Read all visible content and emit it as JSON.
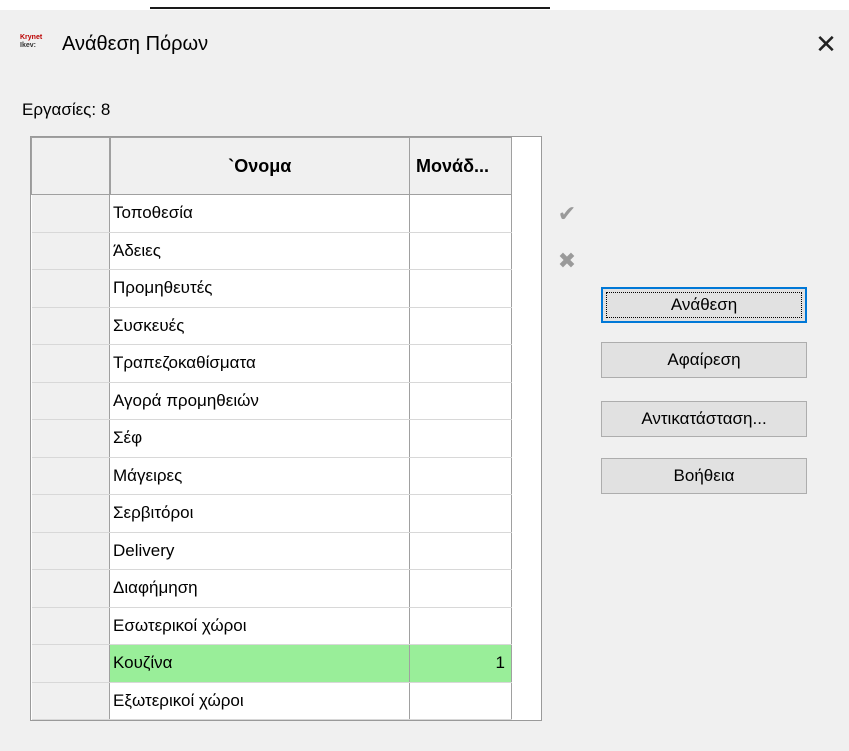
{
  "window": {
    "title": "Ανάθεση Πόρων",
    "icon_text_1": "Krynet",
    "icon_text_2": "Ikev:",
    "close_icon": "close-x-icon"
  },
  "tasks_label": "Εργασίες: 8",
  "table": {
    "columns": [
      "",
      "`Ονομα",
      "Μονάδ..."
    ],
    "rows": [
      {
        "name": "Τοποθεσία",
        "units": ""
      },
      {
        "name": "Άδειες",
        "units": ""
      },
      {
        "name": "Προμηθευτές",
        "units": ""
      },
      {
        "name": "Συσκευές",
        "units": ""
      },
      {
        "name": "Τραπεζοκαθίσματα",
        "units": ""
      },
      {
        "name": "Αγορά προμηθειών",
        "units": ""
      },
      {
        "name": "Σέφ",
        "units": ""
      },
      {
        "name": "Μάγειρες",
        "units": ""
      },
      {
        "name": "Σερβιτόροι",
        "units": ""
      },
      {
        "name": "Delivery",
        "units": ""
      },
      {
        "name": "Διαφήμηση",
        "units": ""
      },
      {
        "name": "Εσωτερικοί χώροι",
        "units": ""
      },
      {
        "name": "Κουζίνα",
        "units": "1",
        "selected": true
      },
      {
        "name": "Εξωτερικοί χώροι",
        "units": ""
      }
    ]
  },
  "edit_icons": {
    "accept": "checkmark-icon",
    "cancel": "x-icon",
    "accept_glyph": "✔",
    "cancel_glyph": "✖"
  },
  "buttons": {
    "assign": "Ανάθεση",
    "remove": "Αφαίρεση",
    "replace": "Αντικατάσταση...",
    "help": "Βοήθεια"
  },
  "colors": {
    "selected_row": "#99ee99",
    "default_button_border": "#0078d7"
  }
}
